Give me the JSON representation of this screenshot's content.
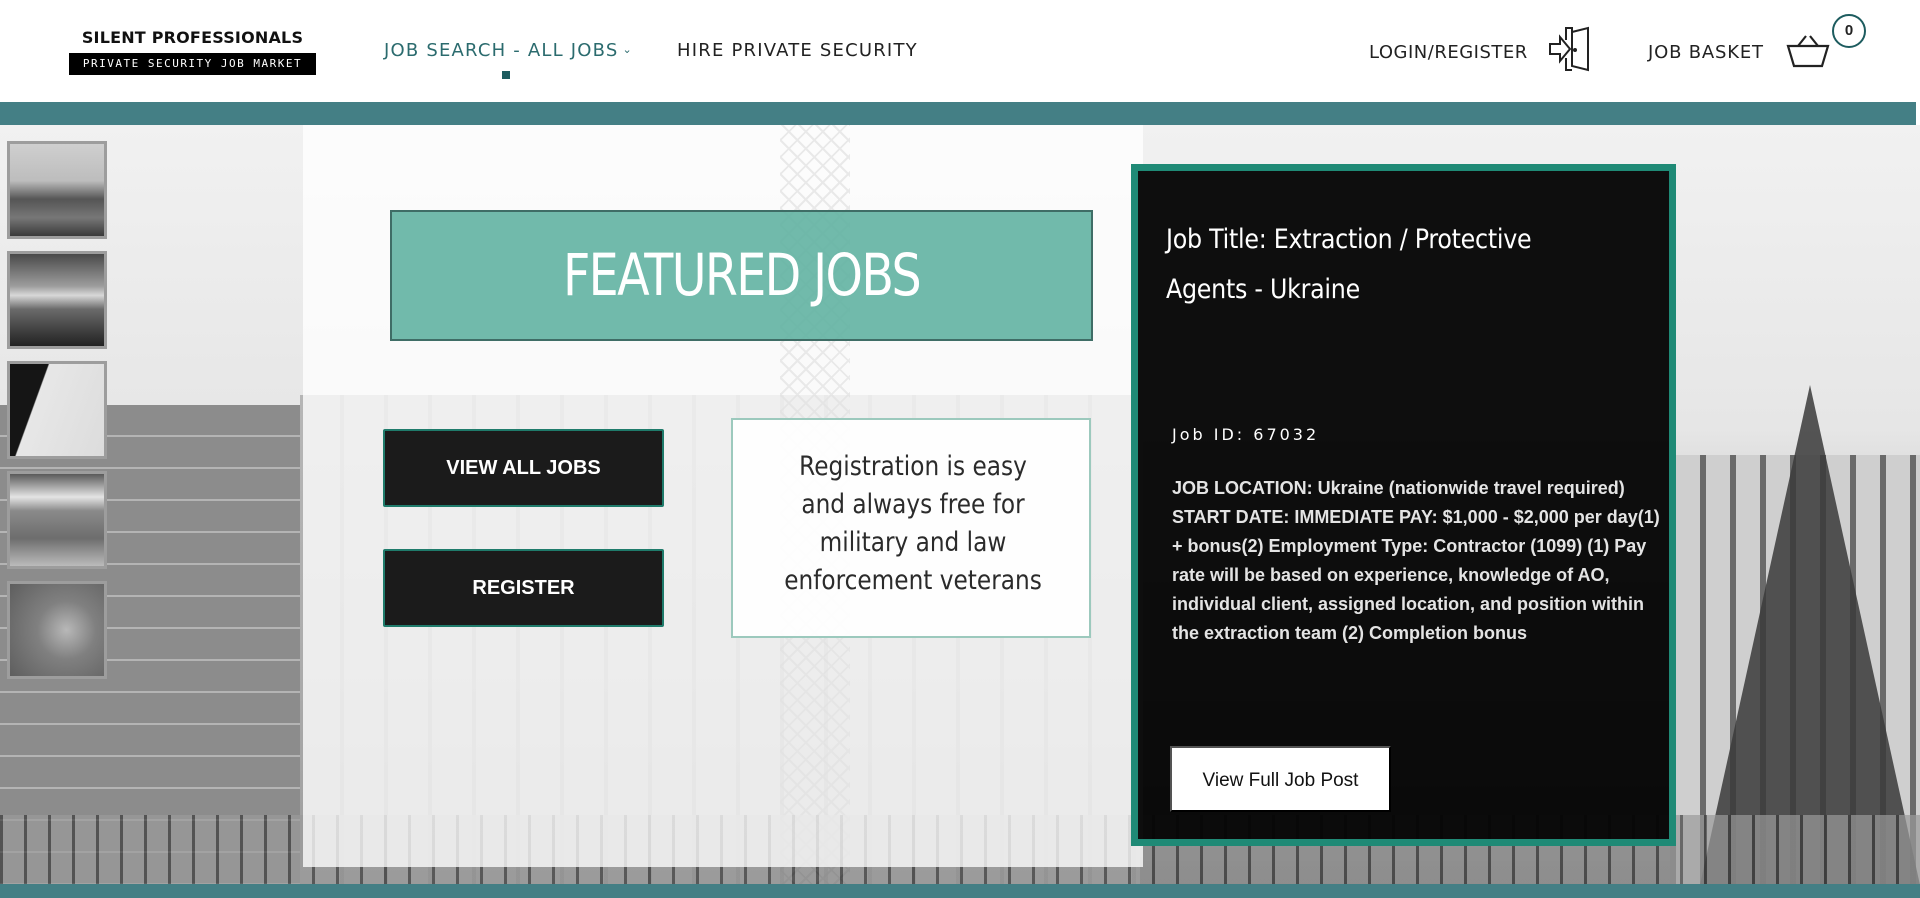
{
  "header": {
    "logo": {
      "top_text": "SILENT PROFESSIONALS",
      "bottom_text": "PRIVATE SECURITY JOB MARKET"
    },
    "nav": [
      {
        "label": "JOB SEARCH - ALL JOBS",
        "has_dropdown": true,
        "active": true
      },
      {
        "label": "HIRE PRIVATE SECURITY",
        "has_dropdown": false,
        "active": false
      }
    ],
    "login_label": "LOGIN/REGISTER",
    "login_icon": "login-door-icon",
    "basket_label": "JOB BASKET",
    "basket_icon": "basket-icon",
    "basket_count": "0"
  },
  "hero": {
    "thumbnails": [
      {
        "icon": "thumbnail-power-plant"
      },
      {
        "icon": "thumbnail-sunset-sea"
      },
      {
        "icon": "thumbnail-map"
      },
      {
        "icon": "thumbnail-aerial-river"
      },
      {
        "icon": "thumbnail-terrain"
      }
    ],
    "featured_title": "FEATURED JOBS",
    "view_all_label": "VIEW ALL JOBS",
    "register_label": "REGISTER",
    "registration_text": "Registration is easy and always free for military and law enforcement veterans"
  },
  "job_card": {
    "title": "Job Title: Extraction / Protective Agents - Ukraine",
    "job_id": "Job ID: 67032",
    "description": "JOB LOCATION:  Ukraine (nationwide travel required) START DATE: IMMEDIATE PAY: $1,000 - $2,000 per day(1) + bonus(2) Employment Type: Contractor (1099) (1) Pay rate will be based on experience, knowledge of AO, individual client, assigned location, and position within the extraction team (2) Completion bonus",
    "button_label": "View Full Job Post"
  },
  "colors": {
    "accent_teal": "#447f85",
    "featured_green": "#5db09f",
    "card_border": "#1f8a76",
    "nav_active": "#2b6b6e"
  }
}
